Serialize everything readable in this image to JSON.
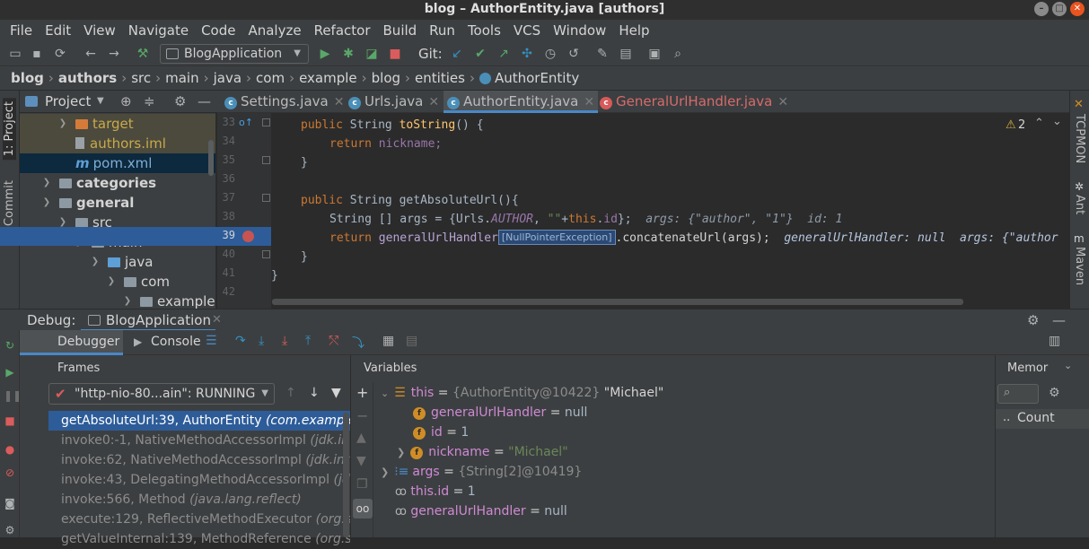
{
  "window": {
    "title": "blog – AuthorEntity.java [authors]",
    "min": "–",
    "max": "□",
    "close": "✕"
  },
  "menu": [
    "File",
    "Edit",
    "View",
    "Navigate",
    "Code",
    "Analyze",
    "Refactor",
    "Build",
    "Run",
    "Tools",
    "VCS",
    "Window",
    "Help"
  ],
  "toolbar": {
    "run_config": "BlogApplication",
    "git_label": "Git:"
  },
  "breadcrumb": [
    "blog",
    "authors",
    "src",
    "main",
    "java",
    "com",
    "example",
    "blog",
    "entities",
    "AuthorEntity"
  ],
  "project": {
    "header": "Project",
    "items": [
      {
        "label": "target",
        "kind": "folder-orange"
      },
      {
        "label": "authors.iml",
        "kind": "file-iml"
      },
      {
        "label": "pom.xml",
        "kind": "file-maven"
      },
      {
        "label": "categories",
        "kind": "module"
      },
      {
        "label": "general",
        "kind": "module"
      },
      {
        "label": "src",
        "kind": "folder"
      },
      {
        "label": "main",
        "kind": "folder"
      },
      {
        "label": "java",
        "kind": "folder-blue"
      },
      {
        "label": "com",
        "kind": "package"
      },
      {
        "label": "example",
        "kind": "package"
      }
    ]
  },
  "left_tabs": {
    "project": "1: Project",
    "commit": "0: Commit"
  },
  "right_tabs": {
    "tcpmon": "TCPMON",
    "ant": "Ant",
    "maven": "Maven"
  },
  "editor": {
    "tabs": [
      "Settings.java",
      "Urls.java",
      "AuthorEntity.java",
      "GeneralUrlHandler.java"
    ],
    "active_tab": "AuthorEntity.java",
    "warning_count": "2",
    "line_numbers": [
      "33",
      "34",
      "35",
      "36",
      "37",
      "38",
      "39",
      "40",
      "41",
      "42"
    ],
    "lines": {
      "l33_kw": "public",
      "l33_type": "String",
      "l33_fn": "toString",
      "l33_rest": "() {",
      "l34_kw": "return",
      "l34_rest": "nickname;",
      "l35": "}",
      "l37_kw": "public",
      "l37_type": "String",
      "l37_rest": "getAbsoluteUrl(){",
      "l38_a": "String [] args = {Urls.",
      "l38_fld": "AUTHOR",
      "l38_b": ", ",
      "l38_str": "\"\"",
      "l38_c": "+",
      "l38_kw": "this",
      "l38_d": ".",
      "l38_fld2": "id",
      "l38_e": "};",
      "l38_hint": "args: {\"author\", \"1\"}  id: 1",
      "l39_kw": "return",
      "l39_fld": "generalUrlHandler",
      "l39_badge": "[NullPointerException]",
      "l39_rest": ".concatenateUrl(args);",
      "l39_hint": "generalUrlHandler: null  args: {\"author",
      "l40": "}",
      "l41": "}"
    }
  },
  "debug": {
    "title": "Debug:",
    "session": "BlogApplication",
    "tab_debugger": "Debugger",
    "tab_console": "Console",
    "frames_label": "Frames",
    "thread": "\"http-nio-80...ain\": RUNNING",
    "frames": [
      {
        "name": "getAbsoluteUrl:39, AuthorEntity",
        "pkg": "(com.example.",
        "selected": true
      },
      {
        "name": "invoke0:-1, NativeMethodAccessorImpl",
        "pkg": "(jdk.inte"
      },
      {
        "name": "invoke:62, NativeMethodAccessorImpl",
        "pkg": "(jdk.inte"
      },
      {
        "name": "invoke:43, DelegatingMethodAccessorImpl",
        "pkg": "(jdk"
      },
      {
        "name": "invoke:566, Method",
        "pkg": "(java.lang.reflect)"
      },
      {
        "name": "execute:129, ReflectiveMethodExecutor",
        "pkg": "(org.sp"
      },
      {
        "name": "getValueInternal:139, MethodReference",
        "pkg": "(org.sp"
      }
    ],
    "variables_label": "Variables",
    "variables": {
      "this_name": "this",
      "this_type": "{AuthorEntity@10422}",
      "this_val": "\"Michael\"",
      "guh_name": "generalUrlHandler",
      "guh_val": "null",
      "id_name": "id",
      "id_val": "1",
      "nick_name": "nickname",
      "nick_val": "\"Michael\"",
      "args_name": "args",
      "args_type": "{String[2]@10419}",
      "thisid_name": "this.id",
      "thisid_val": "1",
      "guh2_name": "generalUrlHandler",
      "guh2_val": "null",
      "eq": "="
    },
    "memory_label": "Memor",
    "count_label": "Count",
    "count_dots": ".."
  }
}
